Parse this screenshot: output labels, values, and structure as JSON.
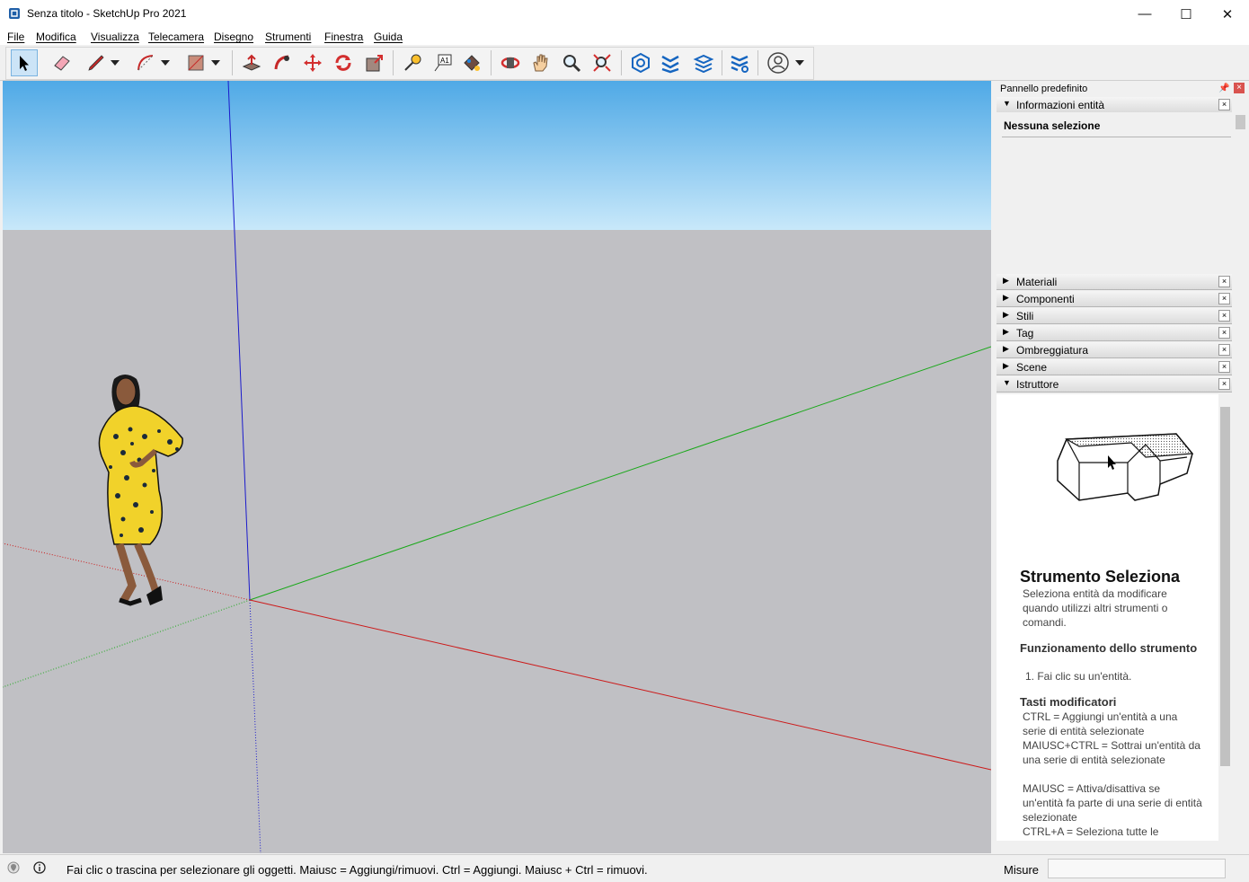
{
  "window": {
    "title": "Senza titolo - SketchUp Pro 2021",
    "minimize": "—",
    "maximize": "☐",
    "close": "✕"
  },
  "menu": [
    "File",
    "Modifica",
    "Visualizza",
    "Telecamera",
    "Disegno",
    "Strumenti",
    "Finestra",
    "Guida"
  ],
  "toolbar": {
    "tools": [
      "select-icon",
      "eraser-icon",
      "pencil-icon",
      "arc-icon",
      "rectangle-icon",
      "push-pull-icon",
      "follow-me-icon",
      "move-icon",
      "rotate-icon",
      "scale-icon",
      "tape-measure-icon",
      "text-icon",
      "paint-bucket-icon",
      "orbit-icon",
      "pan-icon",
      "zoom-icon",
      "zoom-extents-icon",
      "3d-warehouse-icon",
      "extension-warehouse-icon",
      "layout-icon",
      "extension-manager-icon",
      "account-icon"
    ]
  },
  "panel": {
    "title": "Pannello predefinito",
    "entity_info": {
      "label": "Informazioni entità",
      "selection": "Nessuna selezione"
    },
    "trays": [
      "Materiali",
      "Componenti",
      "Stili",
      "Tag",
      "Ombreggiatura",
      "Scene",
      "Istruttore"
    ],
    "instructor": {
      "title": "Strumento Seleziona",
      "description": "Seleziona entità da modificare quando utilizzi altri strumenti o comandi.",
      "operation_heading": "Funzionamento dello strumento",
      "operation_step": "1. Fai clic su un'entità.",
      "modifier_heading": "Tasti modificatori",
      "modifiers": [
        "CTRL = Aggiungi un'entità a una serie di entità selezionate",
        "MAIUSC+CTRL = Sottrai un'entità da una serie di entità selezionate",
        "MAIUSC = Attiva/disattiva se un'entità fa parte di una serie di entità selezionate",
        "CTRL+A = Seleziona tutte le"
      ]
    }
  },
  "status": {
    "text": "Fai clic o trascina per selezionare gli oggetti. Maiusc = Aggiungi/rimuovi. Ctrl = Aggiungi. Maiusc + Ctrl = rimuovi.",
    "measure_label": "Misure",
    "measure_value": ""
  },
  "colors": {
    "x_axis": "#cc0000",
    "y_axis": "#00a000",
    "z_axis": "#0000cc",
    "active_tool": "#cce4f7"
  }
}
